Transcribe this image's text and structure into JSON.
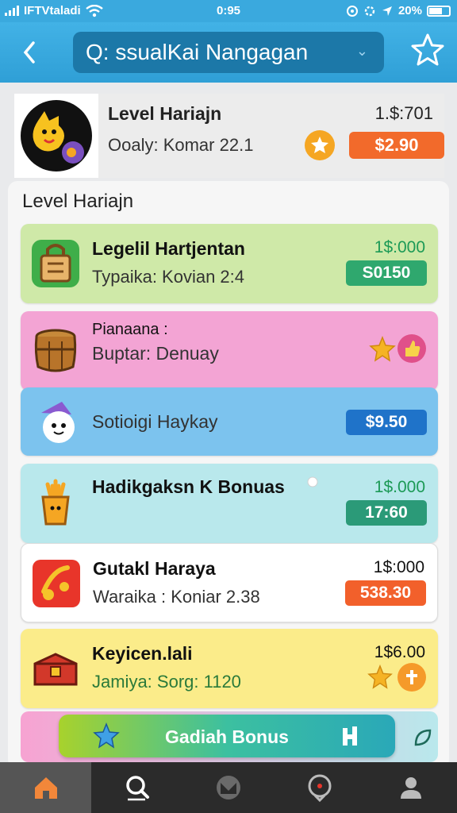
{
  "status": {
    "carrier": "IFTVtaladi",
    "time": "0:95",
    "battery": "20%"
  },
  "header": {
    "search_text": "Q: ssualKai Nangagan",
    "back_label": "<",
    "colors": {
      "bar": "#3aa9de",
      "search_bg": "#1c78a8"
    }
  },
  "top_card": {
    "title": "Level Hariajn",
    "subtitle": "Ooaly: Komar 22.1",
    "price": "1.$:701",
    "badge": "$2.90"
  },
  "panel": {
    "title": "Level Hariajn",
    "rows": [
      {
        "title": "Legelil Hartjentan",
        "subtitle": "Typaika: Kovian 2:4",
        "price": "1$:000",
        "badge": "S0150",
        "bg": "#cfe9a8",
        "badge_color": "#2fa86e",
        "price_color": "#1c9a56"
      },
      {
        "title": "Pianaana :",
        "subtitle": "Buptar: Denuay",
        "bg": "#f3a4d4"
      },
      {
        "label": "Sotioigi Haykay",
        "badge": "$9.50",
        "bg": "#7cc3ee",
        "badge_color": "#1f73c9"
      },
      {
        "title": "Hadikgaksn K Bonuas",
        "price": "1$.000",
        "badge": "17:60",
        "bg": "#b9e8ec",
        "badge_color": "#2b9a78",
        "price_color": "#1c9a56"
      },
      {
        "title": "Gutakl Haraya",
        "subtitle": "Waraika : Koniar 2.38",
        "price": "1$:000",
        "badge": "538.30",
        "bg": "#ffffff",
        "badge_color": "#f2602b",
        "price_color": "#111111"
      },
      {
        "title": "Keyicen.lali",
        "subtitle": "Jamiya: Sorg: 1120",
        "price": "1$6.00",
        "bg": "#fbec8a",
        "price_color": "#111111"
      }
    ]
  },
  "bonus_button": {
    "label": "Gadiah Bonus"
  },
  "nav": {
    "items": [
      {
        "icon": "home-icon",
        "active": true
      },
      {
        "icon": "search-icon",
        "active": false
      },
      {
        "icon": "map-icon",
        "active": false
      },
      {
        "icon": "location-icon",
        "active": false
      },
      {
        "icon": "profile-icon",
        "active": false
      }
    ]
  }
}
